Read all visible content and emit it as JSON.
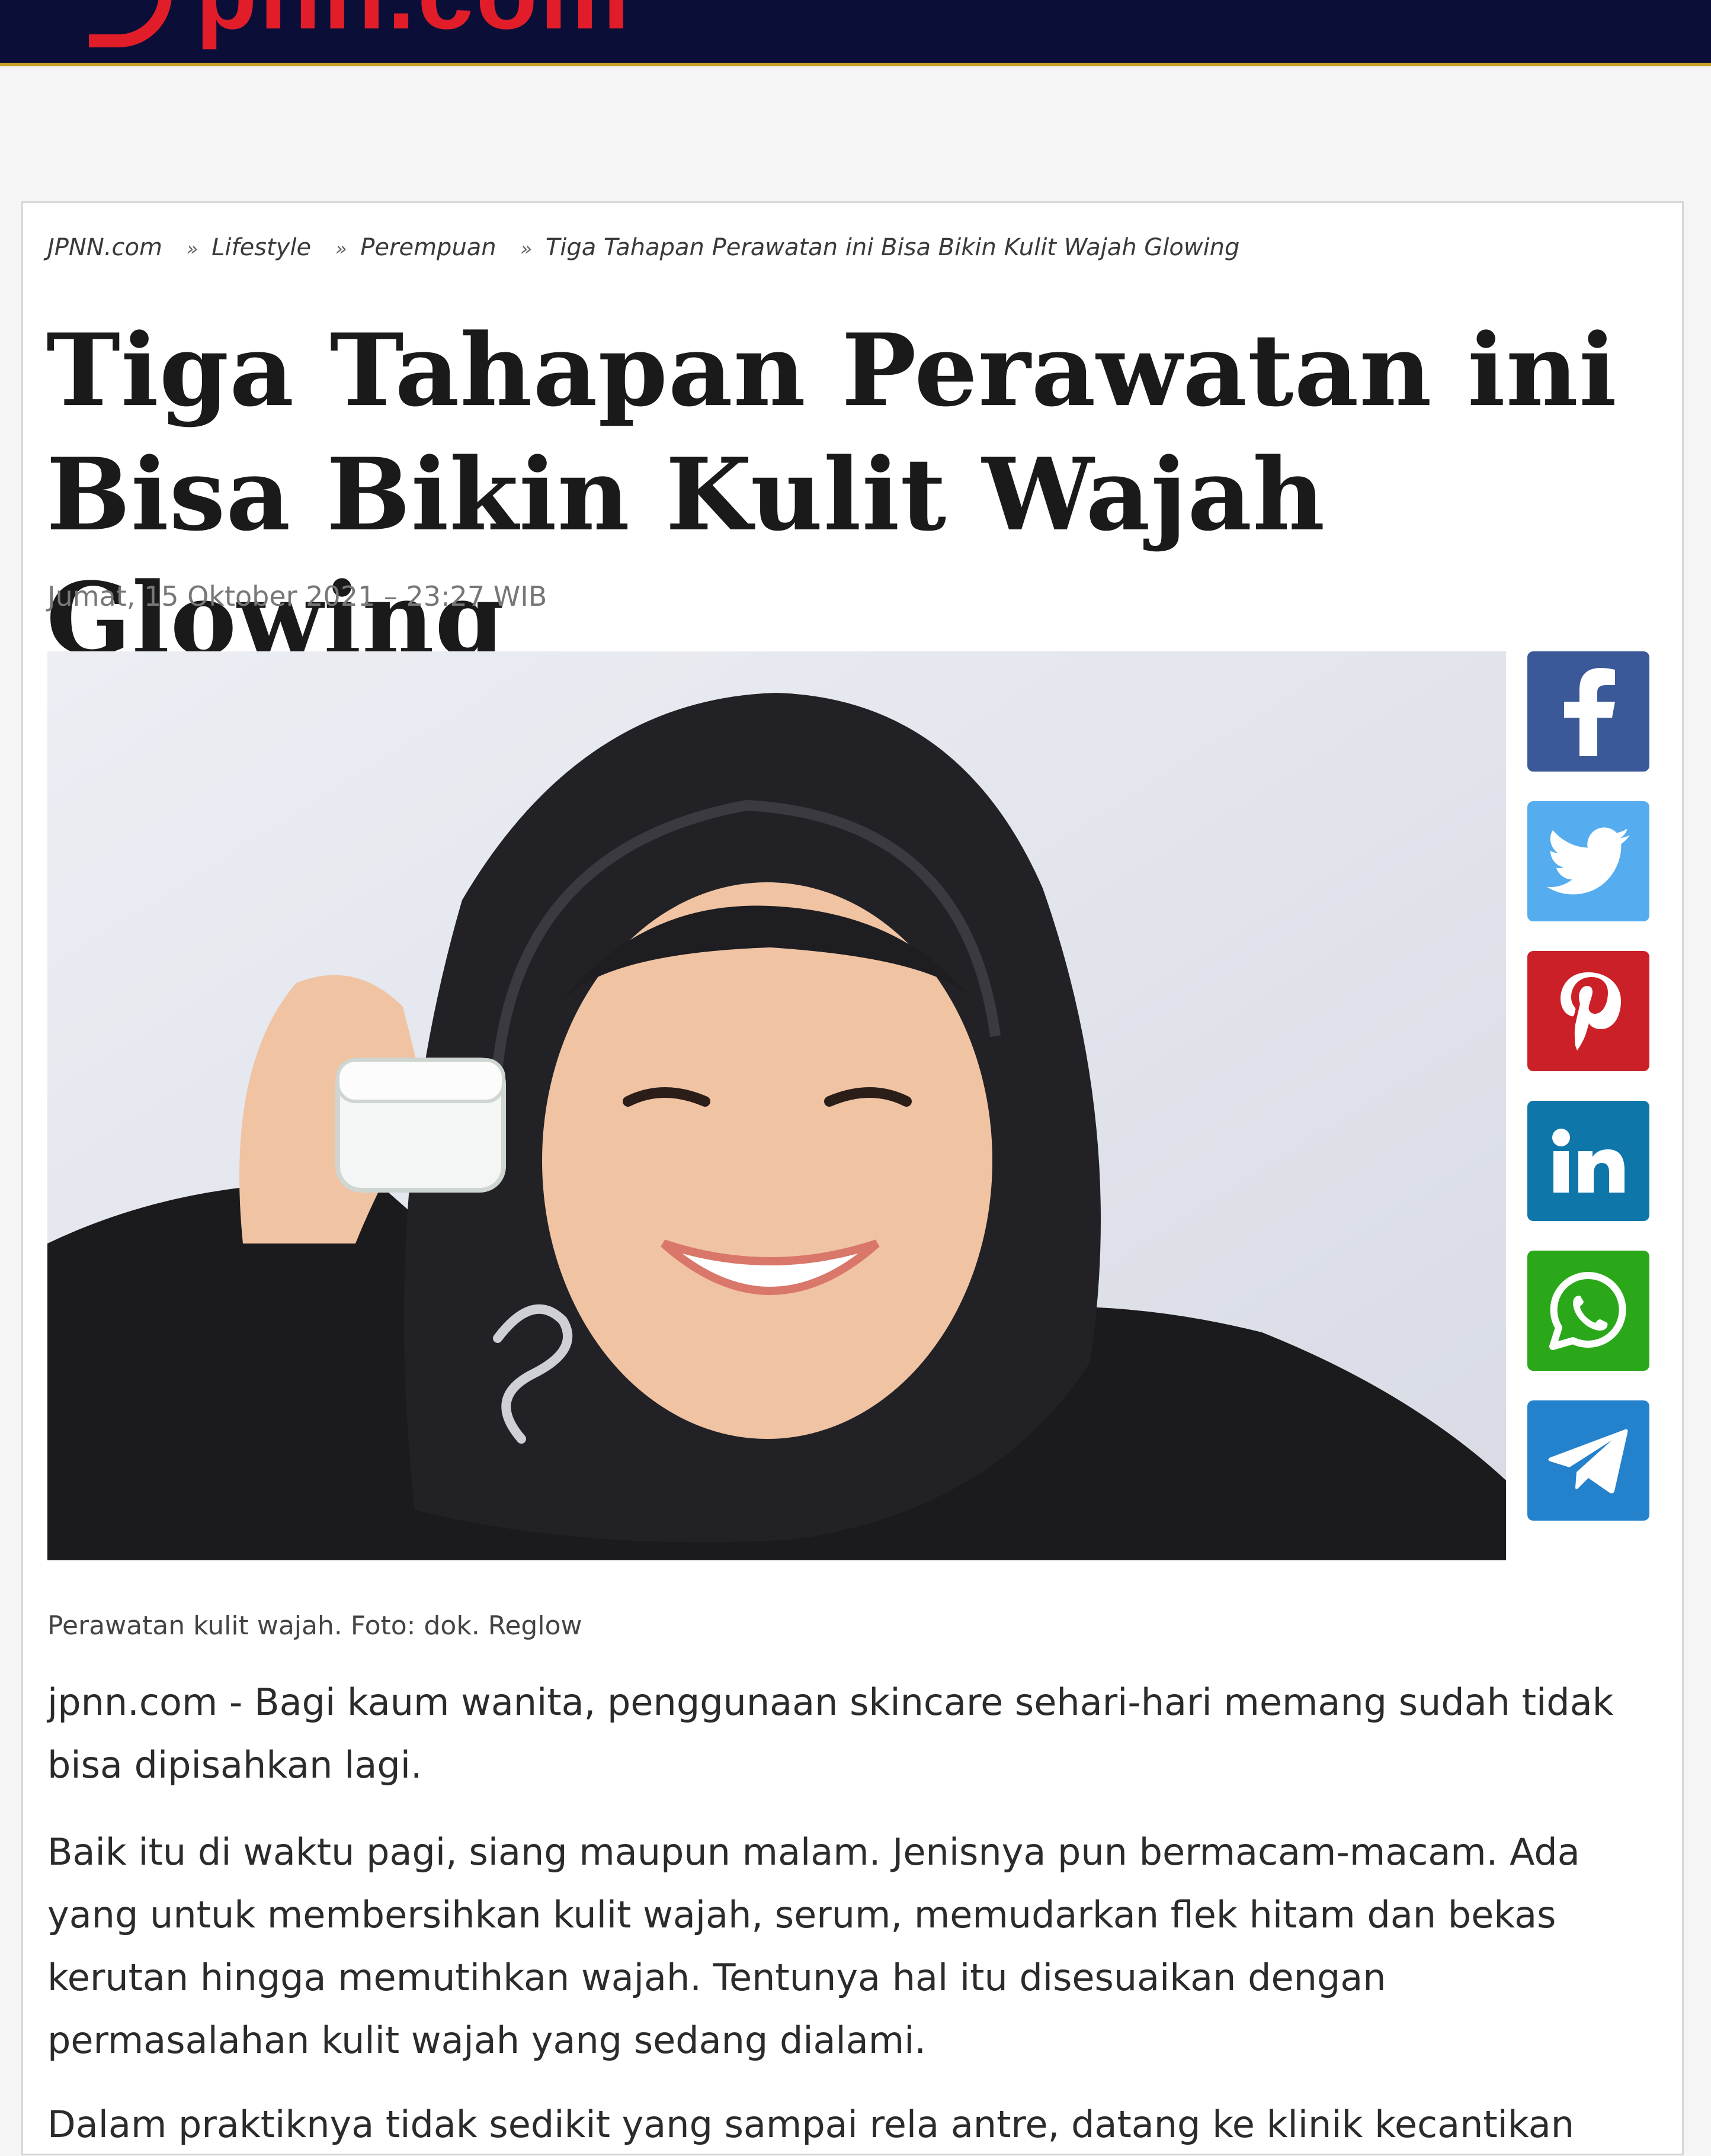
{
  "header": {
    "logo_text": "pnn.com"
  },
  "breadcrumb": {
    "items": [
      "JPNN.com",
      "Lifestyle",
      "Perempuan",
      "Tiga Tahapan Perawatan ini Bisa Bikin Kulit Wajah Glowing"
    ],
    "separator": "»"
  },
  "article": {
    "title": "Tiga Tahapan Perawatan ini Bisa Bikin Kulit Wajah Glowing",
    "date": "Jumat, 15 Oktober 2021 – 23:27 WIB",
    "caption": "Perawatan kulit wajah. Foto: dok. Reglow",
    "paragraphs": [
      "jpnn.com - Bagi kaum wanita, penggunaan skincare sehari-hari memang sudah tidak bisa dipisahkan lagi.",
      "Baik itu di waktu pagi, siang maupun malam. Jenisnya pun bermacam-macam. Ada yang untuk membersihkan kulit wajah, serum, memudarkan flek hitam dan bekas kerutan hingga memutihkan wajah. Tentunya hal itu disesuaikan dengan permasalahan kulit wajah yang sedang dialami.",
      "Dalam praktiknya tidak sedikit yang sampai rela antre, datang ke klinik kecantikan"
    ]
  },
  "share": [
    {
      "network": "facebook",
      "icon": "facebook-icon",
      "color": "#3b5998"
    },
    {
      "network": "twitter",
      "icon": "twitter-icon",
      "color": "#55acee"
    },
    {
      "network": "pinterest",
      "icon": "pinterest-icon",
      "color": "#cb2027"
    },
    {
      "network": "linkedin",
      "icon": "linkedin-icon",
      "color": "#0e76a8"
    },
    {
      "network": "whatsapp",
      "icon": "whatsapp-icon",
      "color": "#2aa81a"
    },
    {
      "network": "telegram",
      "icon": "telegram-icon",
      "color": "#2481cc"
    }
  ],
  "colors": {
    "header_bg": "#0b0f38",
    "header_border": "#c9a227",
    "brand_red": "#e11d2a"
  }
}
